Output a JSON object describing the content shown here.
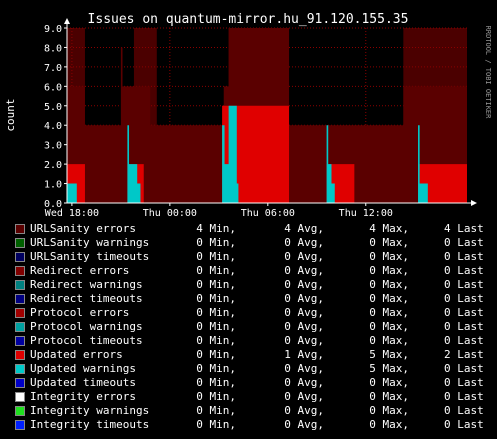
{
  "chart_data": {
    "type": "area",
    "title": "Issues on quantum-mirror.hu_91.120.155.35",
    "ylabel": "count",
    "watermark": "RRDTOOL / TOBI OETIKER",
    "ylim": [
      0,
      9
    ],
    "yticks": [
      "0.0",
      "1.0",
      "2.0",
      "3.0",
      "4.0",
      "5.0",
      "6.0",
      "7.0",
      "8.0",
      "9.0"
    ],
    "xticks": [
      {
        "label": "Wed 18:00",
        "t": 0
      },
      {
        "label": "Thu 00:00",
        "t": 6
      },
      {
        "label": "Thu 06:00",
        "t": 12
      },
      {
        "label": "Thu 12:00",
        "t": 18
      }
    ],
    "x_range_hours": [
      -0.3,
      24.2
    ],
    "grid": true,
    "colors": {
      "urlsanity_errors": "#5a0000",
      "updated_errors": "#e00000",
      "updated_warnings": "#00c8c8",
      "background": "#000000",
      "band_shadow": "#880000",
      "band_light": "#a00000"
    },
    "bands_hours": [
      [
        -0.3,
        0.8
      ],
      [
        3.8,
        5.2
      ],
      [
        9.6,
        13.3
      ],
      [
        20.3,
        24.2
      ]
    ],
    "series": [
      {
        "name": "URLSanity errors",
        "step": [
          [
            -0.3,
            6
          ],
          [
            0.8,
            4
          ],
          [
            3.0,
            8
          ],
          [
            3.1,
            6
          ],
          [
            3.8,
            6
          ],
          [
            4.8,
            4
          ],
          [
            9.3,
            6
          ],
          [
            9.6,
            9
          ],
          [
            13.3,
            4
          ],
          [
            20.3,
            6
          ],
          [
            24.2,
            6
          ]
        ]
      },
      {
        "name": "Updated errors",
        "step": [
          [
            -0.3,
            2
          ],
          [
            0.8,
            0
          ],
          [
            3.4,
            2
          ],
          [
            4.4,
            0
          ],
          [
            9.2,
            5
          ],
          [
            13.3,
            0
          ],
          [
            15.6,
            2
          ],
          [
            17.3,
            0
          ],
          [
            21.2,
            2
          ],
          [
            24.2,
            0
          ]
        ]
      },
      {
        "name": "Updated warnings",
        "step": [
          [
            -0.3,
            1
          ],
          [
            0.3,
            0
          ],
          [
            3.4,
            4
          ],
          [
            3.5,
            2
          ],
          [
            3.8,
            2
          ],
          [
            4.0,
            1
          ],
          [
            4.2,
            0
          ],
          [
            9.2,
            4
          ],
          [
            9.35,
            2
          ],
          [
            9.6,
            5
          ],
          [
            10.1,
            1
          ],
          [
            10.2,
            0
          ],
          [
            15.6,
            4
          ],
          [
            15.7,
            2
          ],
          [
            15.9,
            1
          ],
          [
            16.1,
            0
          ],
          [
            21.2,
            4
          ],
          [
            21.3,
            1
          ],
          [
            21.8,
            0
          ]
        ]
      }
    ]
  },
  "legend": [
    {
      "name": "URLSanity errors",
      "color": "#5a0000",
      "min": "4 Min,",
      "avg": "4 Avg,",
      "max": "4 Max,",
      "last": "4 Last"
    },
    {
      "name": "URLSanity warnings",
      "color": "#006000",
      "min": "0 Min,",
      "avg": "0 Avg,",
      "max": "0 Max,",
      "last": "0 Last"
    },
    {
      "name": "URLSanity timeouts",
      "color": "#000060",
      "min": "0 Min,",
      "avg": "0 Avg,",
      "max": "0 Max,",
      "last": "0 Last"
    },
    {
      "name": "Redirect errors",
      "color": "#800000",
      "min": "0 Min,",
      "avg": "0 Avg,",
      "max": "0 Max,",
      "last": "0 Last"
    },
    {
      "name": "Redirect warnings",
      "color": "#008080",
      "min": "0 Min,",
      "avg": "0 Avg,",
      "max": "0 Max,",
      "last": "0 Last"
    },
    {
      "name": "Redirect timeouts",
      "color": "#000080",
      "min": "0 Min,",
      "avg": "0 Avg,",
      "max": "0 Max,",
      "last": "0 Last"
    },
    {
      "name": "Protocol errors",
      "color": "#a00000",
      "min": "0 Min,",
      "avg": "0 Avg,",
      "max": "0 Max,",
      "last": "0 Last"
    },
    {
      "name": "Protocol warnings",
      "color": "#00a0a0",
      "min": "0 Min,",
      "avg": "0 Avg,",
      "max": "0 Max,",
      "last": "0 Last"
    },
    {
      "name": "Protocol timeouts",
      "color": "#0000a0",
      "min": "0 Min,",
      "avg": "0 Avg,",
      "max": "0 Max,",
      "last": "0 Last"
    },
    {
      "name": "Updated errors",
      "color": "#e00000",
      "min": "0 Min,",
      "avg": "1 Avg,",
      "max": "5 Max,",
      "last": "2 Last"
    },
    {
      "name": "Updated warnings",
      "color": "#00c8c8",
      "min": "0 Min,",
      "avg": "0 Avg,",
      "max": "5 Max,",
      "last": "0 Last"
    },
    {
      "name": "Updated timeouts",
      "color": "#0000c8",
      "min": "0 Min,",
      "avg": "0 Avg,",
      "max": "0 Max,",
      "last": "0 Last"
    },
    {
      "name": "Integrity errors",
      "color": "#ffffff",
      "min": "0 Min,",
      "avg": "0 Avg,",
      "max": "0 Max,",
      "last": "0 Last"
    },
    {
      "name": "Integrity warnings",
      "color": "#20e020",
      "min": "0 Min,",
      "avg": "0 Avg,",
      "max": "0 Max,",
      "last": "0 Last"
    },
    {
      "name": "Integrity timeouts",
      "color": "#0020ff",
      "min": "0 Min,",
      "avg": "0 Avg,",
      "max": "0 Max,",
      "last": "0 Last"
    }
  ]
}
